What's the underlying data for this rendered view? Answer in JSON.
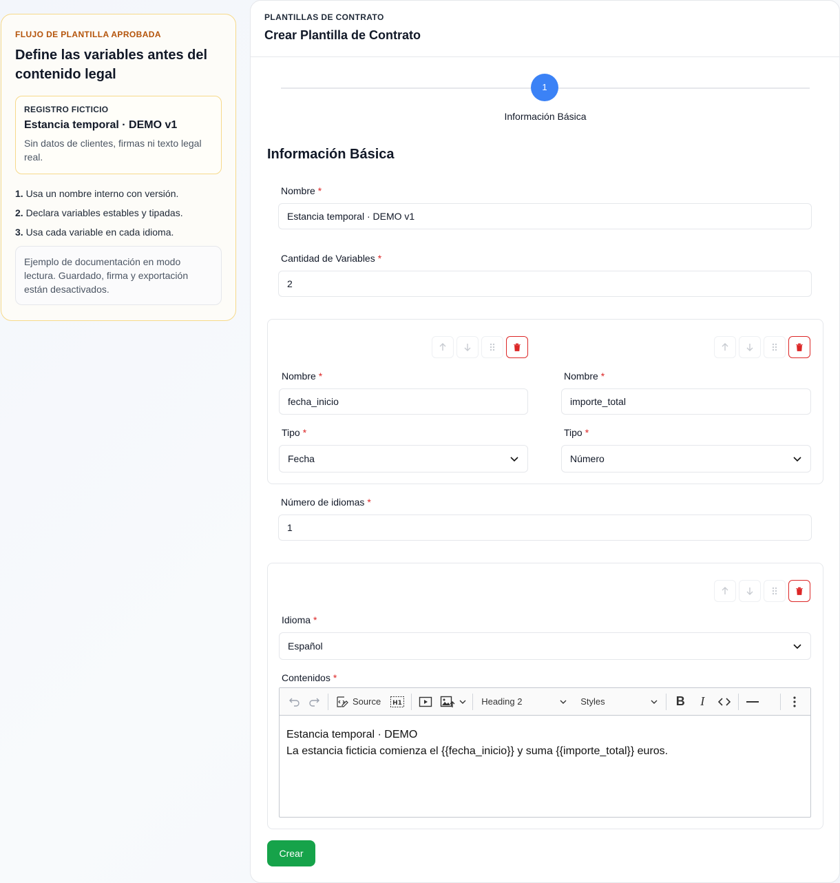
{
  "sidebar": {
    "eyebrow": "FLUJO DE PLANTILLA APROBADA",
    "heading": "Define las variables antes del contenido legal",
    "demo_card": {
      "label": "REGISTRO FICTICIO",
      "title": "Estancia temporal · DEMO v1",
      "description": "Sin datos de clientes, firmas ni texto legal real."
    },
    "steps": [
      {
        "num": "1.",
        "text": "Usa un nombre interno con versión."
      },
      {
        "num": "2.",
        "text": "Declara variables estables y tipadas."
      },
      {
        "num": "3.",
        "text": "Usa cada variable en cada idioma."
      }
    ],
    "note": "Ejemplo de documentación en modo lectura. Guardado, firma y exportación están desactivados."
  },
  "header": {
    "eyebrow": "PLANTILLAS DE CONTRATO",
    "title": "Crear Plantilla de Contrato"
  },
  "stepper": {
    "step_number": "1",
    "step_label": "Información Básica"
  },
  "form": {
    "section_title": "Información Básica",
    "name_label": "Nombre",
    "name_value": "Estancia temporal · DEMO v1",
    "var_count_label": "Cantidad de Variables",
    "var_count_value": "2",
    "variables": [
      {
        "name_label": "Nombre",
        "name_value": "fecha_inicio",
        "type_label": "Tipo",
        "type_value": "Fecha"
      },
      {
        "name_label": "Nombre",
        "name_value": "importe_total",
        "type_label": "Tipo",
        "type_value": "Número"
      }
    ],
    "lang_count_label": "Número de idiomas",
    "lang_count_value": "1",
    "language": {
      "label": "Idioma",
      "value": "Español",
      "contents_label": "Contenidos"
    },
    "required_mark": "*",
    "submit_label": "Crear"
  },
  "editor": {
    "source_label": "Source",
    "heading_label": "Heading 2",
    "styles_label": "Styles",
    "content_line1": "Estancia temporal · DEMO",
    "content_line2": "La estancia ficticia comienza el {{fecha_inicio}} y suma {{importe_total}} euros."
  },
  "colors": {
    "accent": "#3b82f6",
    "create": "#16a34a",
    "danger": "#dc2626",
    "warning_border": "#f6d98a"
  }
}
